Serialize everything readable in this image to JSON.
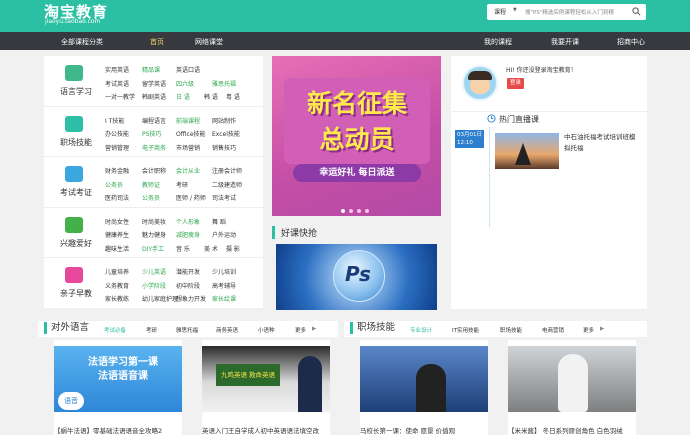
{
  "header": {
    "logo": "淘宝教育",
    "logo_sub": "jiaoyu.taobao.com",
    "search_select": "课程",
    "search_placeholder": "搜\"PS\"精选实例课程轻松从入门到精"
  },
  "nav": [
    "全部课程分类",
    "首页",
    "网络课堂",
    "我的课程",
    "我要开课",
    "招商中心"
  ],
  "categories": [
    {
      "title": "语言学习",
      "color": "#3fb98c",
      "links": [
        [
          "实用英语",
          "精品课",
          "英语口语"
        ],
        [
          "考试英语",
          "留学英语",
          "四六级",
          "雅思托福"
        ],
        [
          "一对一教学",
          "韩剧英语",
          "日 语",
          "韩 语",
          "粤 语"
        ]
      ],
      "green": [
        "精品课",
        "四六级",
        "雅思托福",
        "日 语"
      ]
    },
    {
      "title": "职场技能",
      "color": "#2fbfa8",
      "links": [
        [
          "I T技能",
          "编程语言",
          "前端课程",
          "网站制作"
        ],
        [
          "办公技能",
          "PS技巧",
          "Office技能",
          "Excel技能"
        ],
        [
          "营销管理",
          "电子商务",
          "市场营销",
          "销售技巧"
        ]
      ],
      "green": [
        "前端课程",
        "PS技巧",
        "电子商务"
      ]
    },
    {
      "title": "考试考证",
      "color": "#3aa7e0",
      "links": [
        [
          "财务金融",
          "会计职称",
          "会计从业",
          "注册会计师"
        ],
        [
          "公务员",
          "教师证",
          "考研",
          "二级建造师"
        ],
        [
          "医药司法",
          "公务员",
          "医师 / 药师",
          "司法考试"
        ]
      ],
      "green": [
        "会计从业",
        "教师证",
        "公务员"
      ]
    },
    {
      "title": "兴趣爱好",
      "color": "#43b04a",
      "links": [
        [
          "时尚女性",
          "时尚美妆",
          "个人形象",
          "舞 蹈"
        ],
        [
          "健康养生",
          "魅力健身",
          "减肥瘦身",
          "户外运动"
        ],
        [
          "趣味生活",
          "DIY手工",
          "音 乐",
          "美 术",
          "摄 影"
        ]
      ],
      "green": [
        "个人形象",
        "减肥瘦身",
        "DIY手工"
      ]
    },
    {
      "title": "亲子早教",
      "color": "#e8489c",
      "links": [
        [
          "儿童培养",
          "少儿英语",
          "潜能开发",
          "少儿培训"
        ],
        [
          "义务教育",
          "小学阶段",
          "初中阶段",
          "高考辅导"
        ],
        [
          "家长教练",
          "幼儿家庭护理",
          "想象力开发",
          "家长绘课"
        ]
      ],
      "green": [
        "少儿英语",
        "小学阶段",
        "家长绘课"
      ]
    }
  ],
  "banner": {
    "line1": "新名征集",
    "line2": "总动员",
    "slogan": "幸运好礼  每日派送"
  },
  "quick": {
    "title": "好课快抢",
    "logo": "Ps"
  },
  "side": {
    "greeting": "HI! 你还没登录淘宝教育！",
    "login": "登录",
    "hot_title": "热门直播课",
    "date": "03月01日",
    "time": "12:10",
    "live_title": "中石油托福考试培训班模拟托福"
  },
  "sections": [
    {
      "title": "对外语言",
      "links": [
        "考试必备",
        "考研",
        "雅思托福",
        "商务英语",
        "小语种"
      ],
      "more": "更多"
    },
    {
      "title": "职场技能",
      "links": [
        "专业设计",
        "IT实用技能",
        "职场技能",
        "电商营销"
      ],
      "more": "更多"
    }
  ],
  "cards": [
    {
      "caption": "【蜗牛法语】零基础法语语音全攻略2",
      "t1": "法语学习第一课",
      "t2": "法语语音课",
      "badge": "语音"
    },
    {
      "caption": "英语入门王自学成人初中英语语法填空改",
      "t1": "九鸣英语 救命英语"
    },
    {
      "caption": "马校长第一课：使命 愿景 价值观"
    },
    {
      "caption": "【米米酱】 冬日系列原创角色 白色羽绒"
    }
  ]
}
